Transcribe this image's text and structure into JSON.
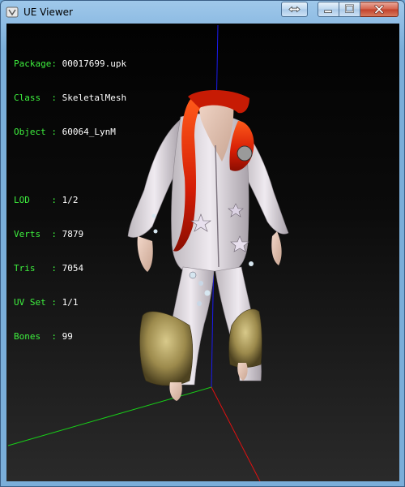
{
  "window": {
    "title": "UE Viewer"
  },
  "icons": {
    "app": "ue-viewer-app-icon",
    "swap": "swap-arrows-icon",
    "minimize": "minimize-icon",
    "maximize": "maximize-icon",
    "close": "close-icon"
  },
  "info": {
    "package": {
      "label": "Package:",
      "value": "00017699.upk"
    },
    "class": {
      "label": "Class  :",
      "value": "SkeletalMesh"
    },
    "object": {
      "label": "Object :",
      "value": "60064_LynM"
    },
    "lod": {
      "label": "LOD    :",
      "value": "1/2"
    },
    "verts": {
      "label": "Verts  :",
      "value": "7879"
    },
    "tris": {
      "label": "Tris   :",
      "value": "7054"
    },
    "uvset": {
      "label": "UV Set :",
      "value": "1/1"
    },
    "bones": {
      "label": "Bones  :",
      "value": "99"
    }
  },
  "colors": {
    "info_label": "#3ef03e",
    "info_value": "#ffffff",
    "axis_x": "#e01010",
    "axis_y": "#18d018",
    "axis_z": "#1a1af0"
  }
}
